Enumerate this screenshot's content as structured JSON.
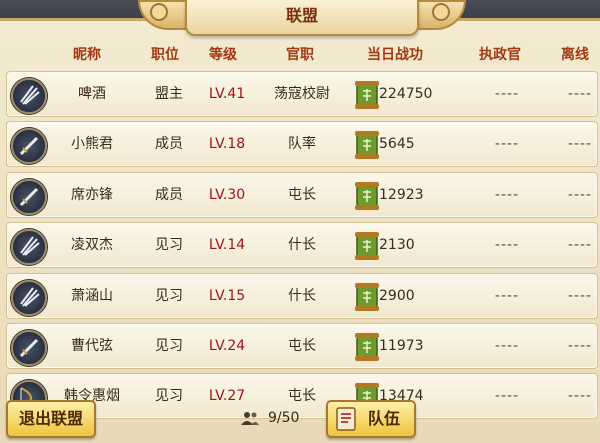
{
  "title": "联盟",
  "headers": {
    "nickname": "昵称",
    "position": "职位",
    "level": "等级",
    "office": "官职",
    "daily_merit": "当日战功",
    "regent": "执政官",
    "offline": "离线"
  },
  "members": [
    {
      "avatar_icon": "fan-icon",
      "name": "啤酒",
      "role": "盟主",
      "level": "LV.41",
      "office": "荡寇校尉",
      "merit": "224750",
      "regent": "----",
      "offline": "----"
    },
    {
      "avatar_icon": "sword-icon",
      "name": "小熊君",
      "role": "成员",
      "level": "LV.18",
      "office": "队率",
      "merit": "5645",
      "regent": "----",
      "offline": "----"
    },
    {
      "avatar_icon": "sword-icon",
      "name": "席亦锋",
      "role": "成员",
      "level": "LV.30",
      "office": "屯长",
      "merit": "12923",
      "regent": "----",
      "offline": "----"
    },
    {
      "avatar_icon": "fan-icon",
      "name": "凌双杰",
      "role": "见习",
      "level": "LV.14",
      "office": "什长",
      "merit": "2130",
      "regent": "----",
      "offline": "----"
    },
    {
      "avatar_icon": "fan-icon",
      "name": "萧涵山",
      "role": "见习",
      "level": "LV.15",
      "office": "什长",
      "merit": "2900",
      "regent": "----",
      "offline": "----"
    },
    {
      "avatar_icon": "sword-icon",
      "name": "曹代弦",
      "role": "见习",
      "level": "LV.24",
      "office": "屯长",
      "merit": "11973",
      "regent": "----",
      "offline": "----"
    },
    {
      "avatar_icon": "bow-icon",
      "name": "韩令惠烟",
      "role": "见习",
      "level": "LV.27",
      "office": "屯长",
      "merit": "13474",
      "regent": "----",
      "offline": "----"
    }
  ],
  "footer": {
    "quit_label": "退出联盟",
    "member_count": "9/50",
    "team_label": "队伍"
  },
  "colors": {
    "header_text": "#a13a12",
    "level_text": "#a3131a",
    "button_gold": "#efc33e"
  }
}
